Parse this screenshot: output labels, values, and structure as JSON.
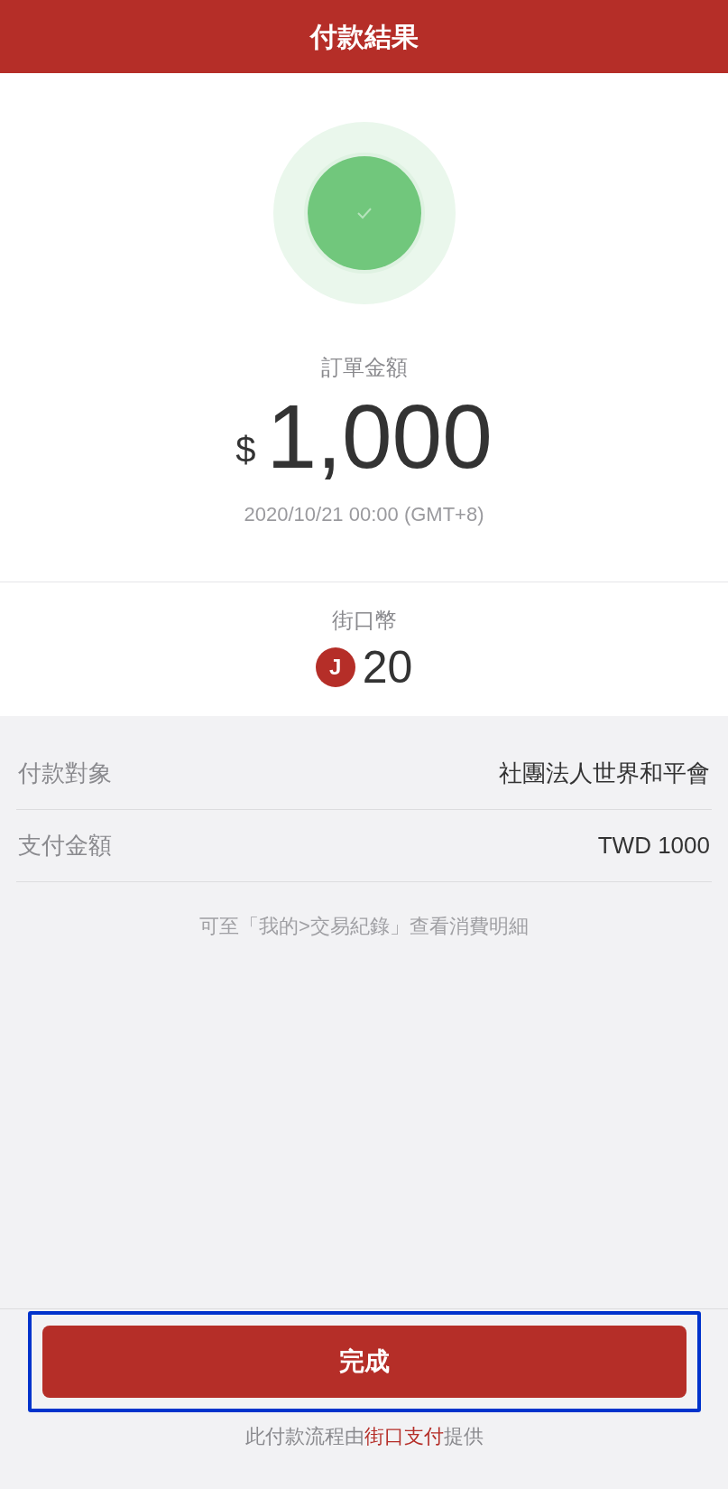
{
  "header": {
    "title": "付款結果"
  },
  "status": {
    "kind": "success"
  },
  "order": {
    "label": "訂單金額",
    "currency": "$",
    "amount": "1,000",
    "time": "2020/10/21 00:00 (GMT+8)"
  },
  "coins": {
    "label": "街口幣",
    "badge": "J",
    "amount": "20"
  },
  "details": [
    {
      "label": "付款對象",
      "value": "社團法人世界和平會"
    },
    {
      "label": "支付金額",
      "value": "TWD 1000"
    }
  ],
  "note": "可至「我的>交易紀錄」查看消費明細",
  "button": {
    "label": "完成",
    "highlighted": true
  },
  "footer": {
    "prefix": "此付款流程由",
    "link": "街口支付",
    "suffix": "提供"
  }
}
